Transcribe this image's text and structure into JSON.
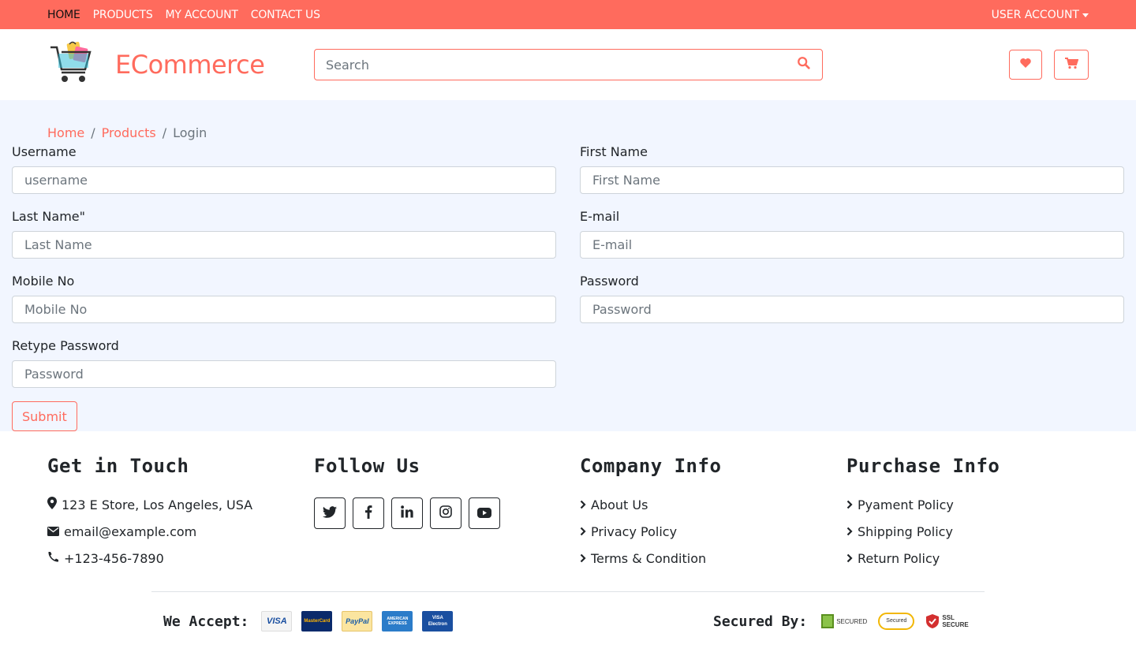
{
  "topbar": {
    "nav": [
      "HOME",
      "PRODUCTS",
      "MY ACCOUNT",
      "CONTACT US"
    ],
    "user_account": "USER ACCOUNT"
  },
  "header": {
    "logo_text": "ECommerce",
    "search_placeholder": "Search"
  },
  "breadcrumb": {
    "home": "Home",
    "products": "Products",
    "current": "Login"
  },
  "form": {
    "username": {
      "label": "Username",
      "placeholder": "username"
    },
    "first_name": {
      "label": "First Name",
      "placeholder": "First Name"
    },
    "last_name": {
      "label": "Last Name\"",
      "placeholder": "Last Name"
    },
    "email": {
      "label": "E-mail",
      "placeholder": "E-mail"
    },
    "mobile": {
      "label": "Mobile No",
      "placeholder": "Mobile No"
    },
    "password": {
      "label": "Password",
      "placeholder": "Password"
    },
    "retype": {
      "label": "Retype Password",
      "placeholder": "Password"
    },
    "submit": "Submit"
  },
  "footer": {
    "touch": {
      "title": "Get in Touch",
      "address": "123 E Store, Los Angeles, USA",
      "email": "email@example.com",
      "phone": "+123-456-7890"
    },
    "follow": {
      "title": "Follow Us",
      "icons": [
        "twitter-icon",
        "facebook-icon",
        "linkedin-icon",
        "instagram-icon",
        "youtube-icon"
      ]
    },
    "company": {
      "title": "Company Info",
      "links": [
        "About Us",
        "Privacy Policy",
        "Terms & Condition"
      ]
    },
    "purchase": {
      "title": "Purchase Info",
      "links": [
        "Pyament Policy",
        "Shipping Policy",
        "Return Policy"
      ]
    },
    "accept_label": "We Accept:",
    "cards": [
      "VISA",
      "MasterCard",
      "PayPal",
      "AMERICAN EXPRESS",
      "VISA Electron"
    ],
    "secured_label": "Secured By:",
    "seals": [
      "SECURED",
      "Secured",
      "SSL SECURE"
    ]
  },
  "colors": {
    "accent": "#ff6b5d",
    "main_bg": "#f2f6ff"
  }
}
